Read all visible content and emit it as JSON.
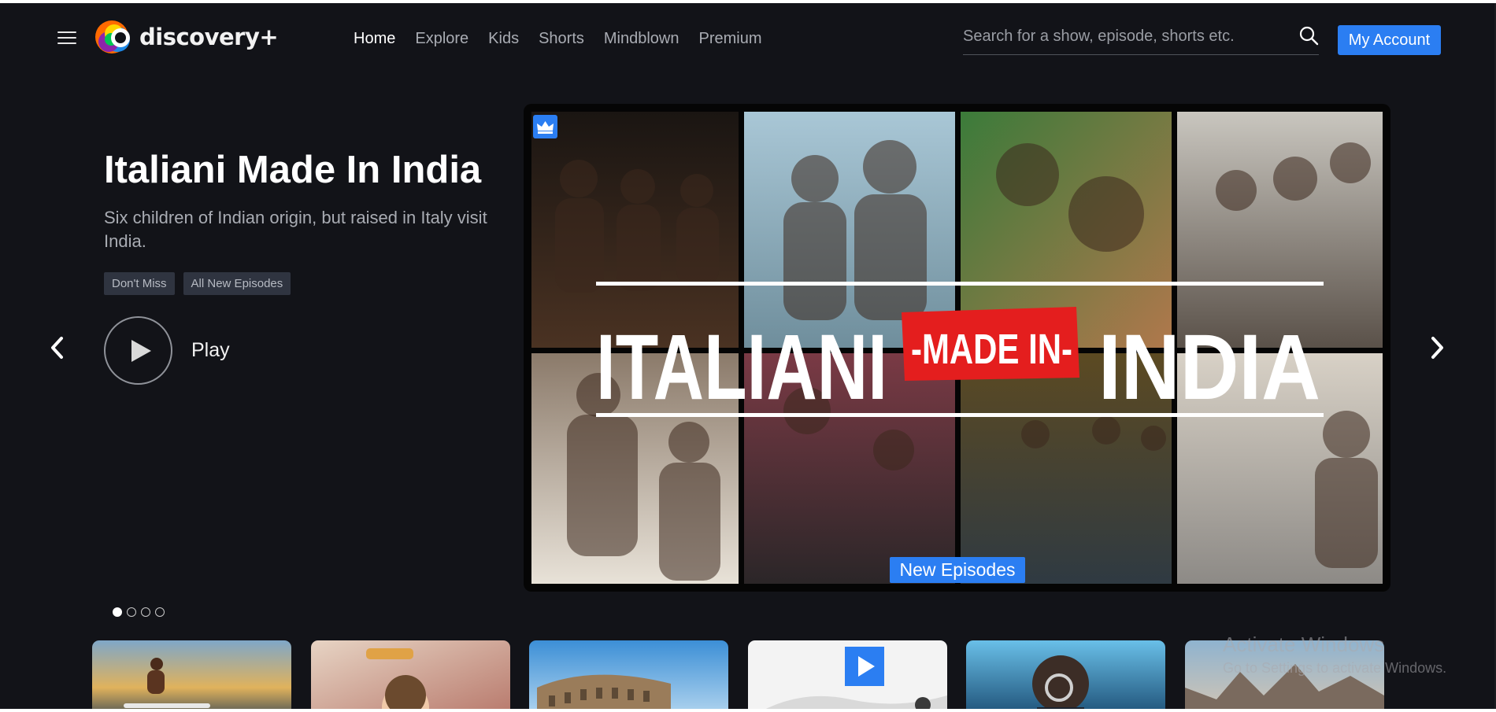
{
  "app": {
    "name": "discovery+",
    "brand_color": "#2b7ef2",
    "background_color": "#121318"
  },
  "header": {
    "menu_icon": "hamburger-menu-icon",
    "logo_text": "discovery+",
    "nav": [
      {
        "label": "Home",
        "active": true
      },
      {
        "label": "Explore",
        "active": false
      },
      {
        "label": "Kids",
        "active": false
      },
      {
        "label": "Shorts",
        "active": false
      },
      {
        "label": "Mindblown",
        "active": false
      },
      {
        "label": "Premium",
        "active": false
      }
    ],
    "search": {
      "placeholder": "Search for a show, episode, shorts etc.",
      "value": "",
      "icon": "search-icon"
    },
    "account_button": "My Account"
  },
  "hero": {
    "title": "Italiani Made In India",
    "description": "Six children of Indian origin, but raised in Italy visit India.",
    "tags": [
      "Don't Miss",
      "All New Episodes"
    ],
    "play_label": "Play",
    "image_text": {
      "left": "ITALIANI",
      "middle": "-MADE IN-",
      "right": "INDIA"
    },
    "badge": "New Episodes",
    "premium_icon": "crown-icon",
    "prev_icon": "chevron-left-icon",
    "next_icon": "chevron-right-icon"
  },
  "carousel": {
    "slide_count": 4,
    "active_index": 0
  },
  "rail": {
    "cards": [
      {
        "name": "surfer-card"
      },
      {
        "name": "kid-airplane-card"
      },
      {
        "name": "colosseum-card"
      },
      {
        "name": "video-play-card"
      },
      {
        "name": "magnifier-card"
      },
      {
        "name": "canyon-card"
      }
    ]
  },
  "os_watermark": {
    "title": "Activate Windows",
    "subtitle": "Go to Settings to activate Windows."
  }
}
